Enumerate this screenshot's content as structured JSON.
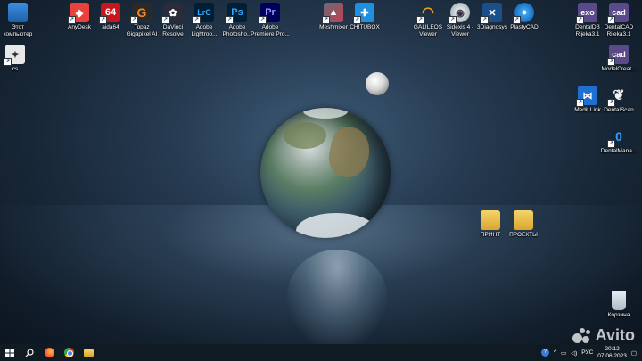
{
  "desktop_icons": {
    "this_pc": "Этот\nкомпьютер",
    "cs": "cs",
    "anydesk": "AnyDesk",
    "aida64": "aida64",
    "topaz": "Topaz\nGigapixel AI",
    "davinci": "DaVinci\nResolve",
    "lightroom": "Adobe\nLightroo...",
    "photoshop": "Adobe\nPhotosho...",
    "premiere": "Adobe\nPremiere Pro...",
    "meshmixer": "Meshmixer",
    "chitubox": "CHITUBOX",
    "galileos": "GALILEOS\nViewer",
    "sidexis": "Sidexis 4 -\nViewer",
    "3diagnosys": "3Diagnosys",
    "plastycad": "PlastyCAD",
    "dentaldb": "DentalDB\nRijeka3.1",
    "dentalcad": "DentalCAD\nRijeka3.1",
    "modelcreator": "ModelCreat...",
    "medit": "Medit Link",
    "dentalscan": "DentalScan",
    "dentalmanager": "DentalMana...",
    "print": "ПРИНТ",
    "projects": "ПРОЕКТЫ",
    "recycle": "Корзина"
  },
  "tile_glyphs": {
    "aida64": "64",
    "lightroom": "LrC",
    "photoshop": "Ps",
    "premiere": "Pr",
    "exo": "exo",
    "cad": "cad"
  },
  "taskbar": {
    "language": "РУС",
    "time": "20:12",
    "date": "07.06.2023"
  },
  "watermark": "Avito"
}
